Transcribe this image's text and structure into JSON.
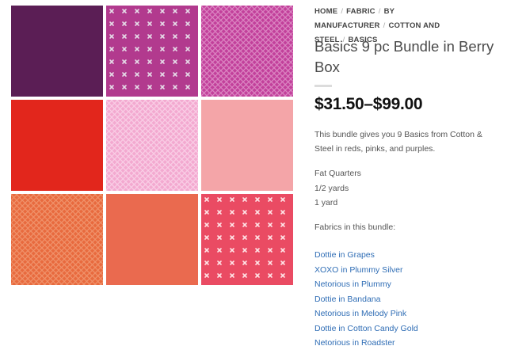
{
  "breadcrumb": {
    "items": [
      {
        "label": "Home"
      },
      {
        "label": "Fabric"
      },
      {
        "label": "By Manufacturer"
      },
      {
        "label": "Cotton and Steel"
      },
      {
        "label": "Basics"
      }
    ]
  },
  "product": {
    "title": "Basics 9 pc Bundle in Berry Box",
    "price": "$31.50–$99.00",
    "description": "This bundle gives you 9 Basics from Cotton & Steel in reds, pinks, and purples.",
    "sizes": [
      "Fat Quarters",
      "1/2 yards",
      "1 yard"
    ],
    "fabrics_label": "Fabrics in this bundle:",
    "fabrics": [
      "Dottie in Grapes",
      "XOXO in Plummy Silver",
      "Netorious in Plummy",
      "Dottie in Bandana",
      "Netorious in Melody Pink",
      "Dottie in Cotton Candy Gold",
      "Netorious in Roadster"
    ]
  },
  "swatches": [
    {
      "name": "dottie-grapes",
      "color": "#5b1e55",
      "accent": "#e8d8e6",
      "pattern": "stripe-dots"
    },
    {
      "name": "xoxo-plummy-silver",
      "color": "#b23a8e",
      "accent": "#e6dce8",
      "pattern": "crosses"
    },
    {
      "name": "netorious-plummy",
      "color": "#c2409b",
      "accent": "#e7a6d4",
      "pattern": "net"
    },
    {
      "name": "dottie-bandana",
      "color": "#e2261c",
      "accent": "#f7c6b5",
      "pattern": "stripe-dots"
    },
    {
      "name": "netorious-melody-pink",
      "color": "#f3a9d0",
      "accent": "#fcdff0",
      "pattern": "net"
    },
    {
      "name": "dottie-cotton-candy-gold",
      "color": "#f4a5a8",
      "accent": "#c9a26a",
      "pattern": "stripe-dots"
    },
    {
      "name": "netorious-roadster",
      "color": "#e86a3e",
      "accent": "#f3a47f",
      "pattern": "net"
    },
    {
      "name": "dottie-coral",
      "color": "#ea6a4f",
      "accent": "#f6b39a",
      "pattern": "stripe-dots"
    },
    {
      "name": "xoxo-red",
      "color": "#ea4b63",
      "accent": "#ffe4e7",
      "pattern": "crosses"
    }
  ]
}
